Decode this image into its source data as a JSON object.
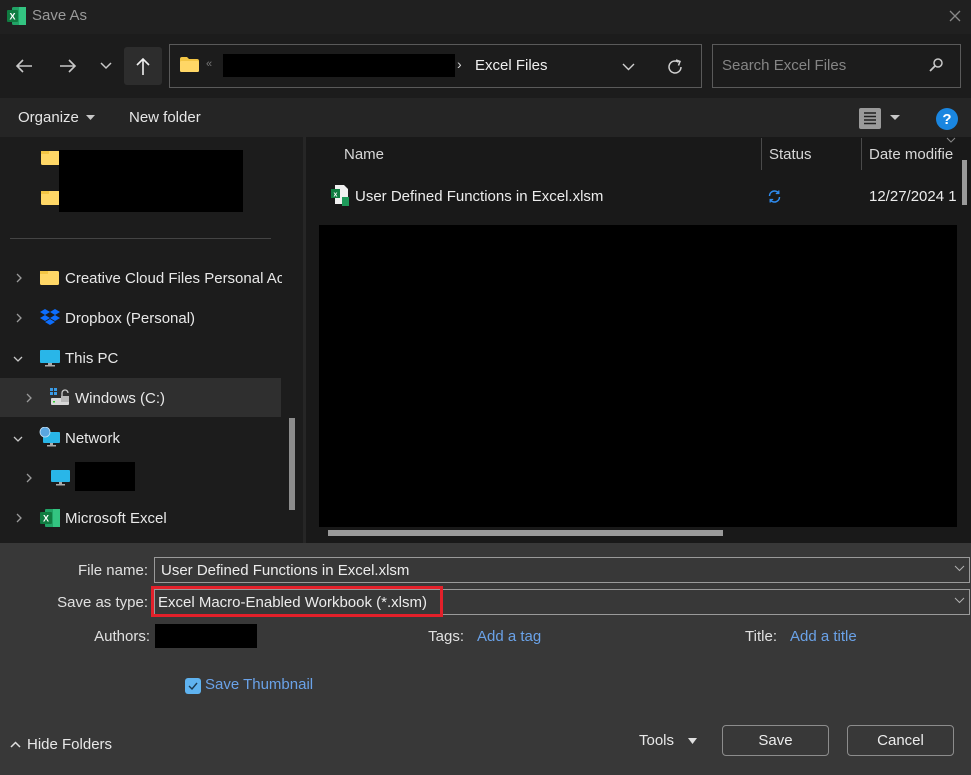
{
  "window": {
    "title": "Save As",
    "app_icon": "excel-icon"
  },
  "nav": {
    "back_icon": "arrow-left-icon",
    "forward_icon": "arrow-right-icon",
    "recent_icon": "chevron-down-icon",
    "up_icon": "arrow-up-icon",
    "address": {
      "overflow_marker": "«",
      "separator": "›",
      "current_folder": "Excel Files"
    },
    "search": {
      "placeholder": "Search Excel Files",
      "value": ""
    }
  },
  "toolbar": {
    "organize_label": "Organize",
    "new_folder_label": "New folder",
    "help_label": "?"
  },
  "nav_pane": {
    "items": [
      {
        "label": "Creative Cloud Files Personal Acc",
        "icon": "folder-icon",
        "expanded": false
      },
      {
        "label": "Dropbox (Personal)",
        "icon": "dropbox-icon",
        "expanded": false
      },
      {
        "label": "This PC",
        "icon": "monitor-icon",
        "expanded": true
      },
      {
        "label": "Windows (C:)",
        "icon": "drive-icon",
        "expanded": false,
        "selected": true
      },
      {
        "label": "Network",
        "icon": "network-icon",
        "expanded": true
      },
      {
        "label": "Microsoft Excel",
        "icon": "excel-icon",
        "expanded": false
      }
    ]
  },
  "file_list": {
    "columns": [
      "Name",
      "Status",
      "Date modifie"
    ],
    "rows": [
      {
        "name": "User Defined Functions in Excel.xlsm",
        "status": "sync-icon",
        "date": "12/27/2024 1"
      }
    ]
  },
  "form": {
    "file_name_label": "File name:",
    "file_name_value": "User Defined Functions in Excel.xlsm",
    "save_type_label": "Save as type:",
    "save_type_value": "Excel Macro-Enabled Workbook (*.xlsm)",
    "authors_label": "Authors:",
    "tags_label": "Tags:",
    "tags_link": "Add a tag",
    "title_label": "Title:",
    "title_link": "Add a title",
    "save_thumbnail_label": "Save Thumbnail",
    "save_thumbnail_checked": true,
    "highlight_color": "#e3202a"
  },
  "footer": {
    "hide_folders_label": "Hide Folders",
    "tools_label": "Tools",
    "save_label": "Save",
    "cancel_label": "Cancel"
  }
}
